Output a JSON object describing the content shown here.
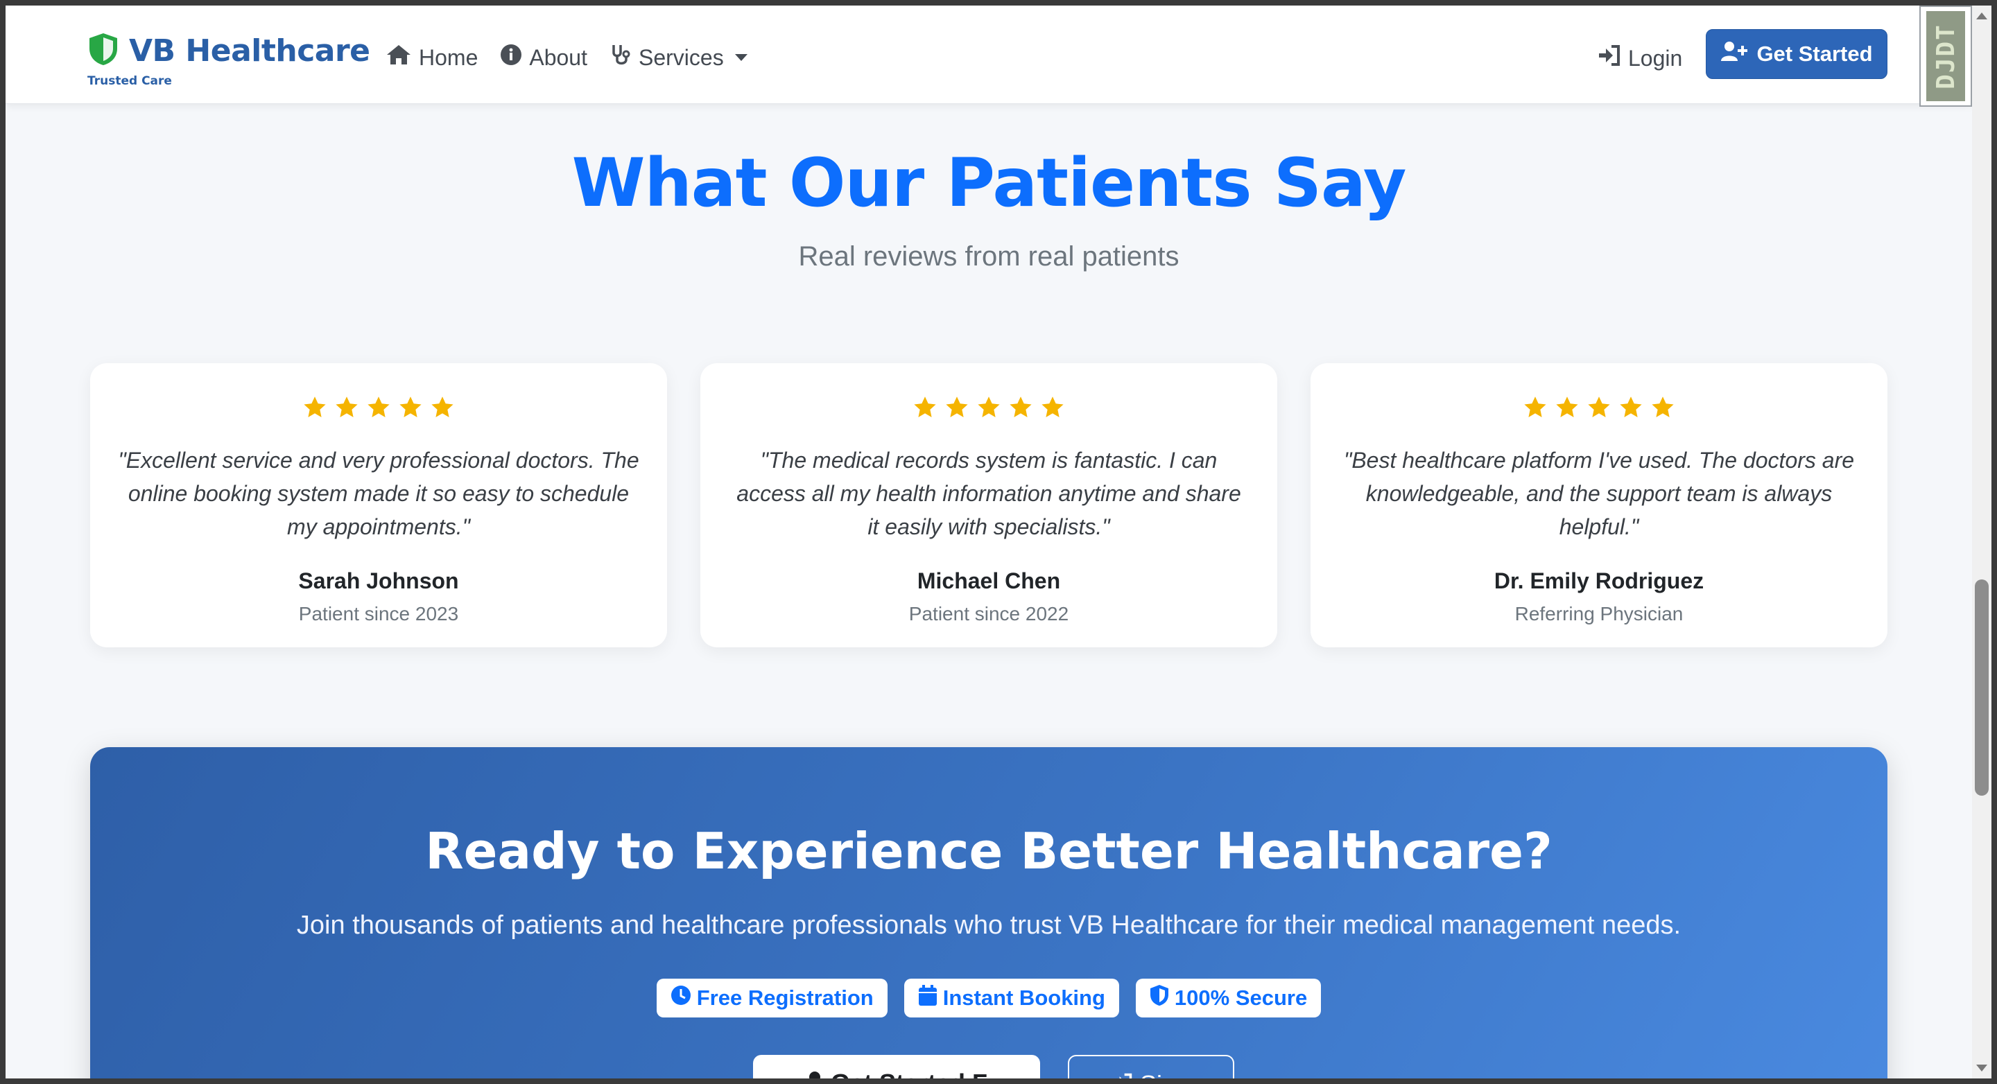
{
  "navbar": {
    "brand_name": "VB Healthcare",
    "brand_tagline": "Trusted Care",
    "links": [
      {
        "label": "Home",
        "icon": "home-icon"
      },
      {
        "label": "About",
        "icon": "info-icon"
      },
      {
        "label": "Services",
        "icon": "stethoscope-icon"
      }
    ],
    "login_label": "Login",
    "get_started_label": "Get Started",
    "extension_badge": "DJDT"
  },
  "testimonials": {
    "title": "What Our Patients Say",
    "subtitle": "Real reviews from real patients",
    "rating_stars": 5,
    "cards": [
      {
        "quote": "\"Excellent service and very professional doctors. The online booking system made it so easy to schedule my appointments.\"",
        "name": "Sarah Johnson",
        "role": "Patient since 2023"
      },
      {
        "quote": "\"The medical records system is fantastic. I can access all my health information anytime and share it easily with specialists.\"",
        "name": "Michael Chen",
        "role": "Patient since 2022"
      },
      {
        "quote": "\"Best healthcare platform I've used. The doctors are knowledgeable, and the support team is always helpful.\"",
        "name": "Dr. Emily Rodriguez",
        "role": "Referring Physician"
      }
    ]
  },
  "cta": {
    "title": "Ready to Experience Better Healthcare?",
    "text": "Join thousands of patients and healthcare professionals who trust VB Healthcare for their medical management needs.",
    "badges": [
      {
        "label": "Free Registration",
        "icon": "clock-icon"
      },
      {
        "label": "Instant Booking",
        "icon": "calendar-icon"
      },
      {
        "label": "100% Secure",
        "icon": "shield-icon"
      }
    ],
    "primary_button": "Get Started F",
    "secondary_button": "Sign"
  },
  "colors": {
    "brand_blue": "#2a5fa6",
    "accent_blue": "#0d6efd",
    "star_gold": "#f5b400",
    "brand_green": "#28a745"
  }
}
